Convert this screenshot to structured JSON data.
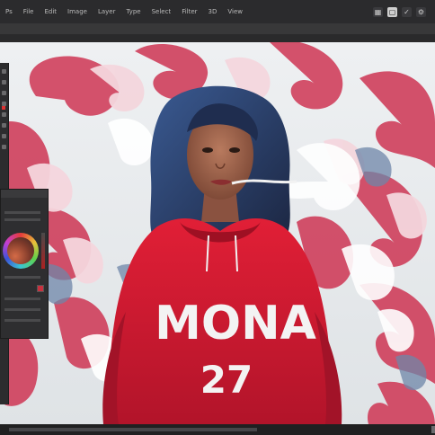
{
  "menu": {
    "items": [
      "Ps",
      "File",
      "Edit",
      "Image",
      "Layer",
      "Type",
      "Select",
      "Filter",
      "3D",
      "View"
    ]
  },
  "toolbar_icons": [
    "move-tool-icon",
    "marquee-tool-icon",
    "lasso-tool-icon",
    "brush-tool-icon",
    "eraser-tool-icon",
    "text-tool-icon",
    "zoom-tool-icon",
    "hand-tool-icon"
  ],
  "options_bar": {
    "left_label": "",
    "mid_label": "",
    "right_label": ""
  },
  "document_tab": {
    "name": "",
    "close": ""
  },
  "artwork": {
    "hoodie_text": "MONA",
    "hoodie_number": "27"
  },
  "color_panel": {
    "title": "",
    "swatch_color": "#c8313f"
  },
  "colors": {
    "accent_red": "#d6213b",
    "smoke_pink": "#e1758c",
    "smoke_white": "#eef1f4",
    "bg_light": "#e8eaec"
  }
}
